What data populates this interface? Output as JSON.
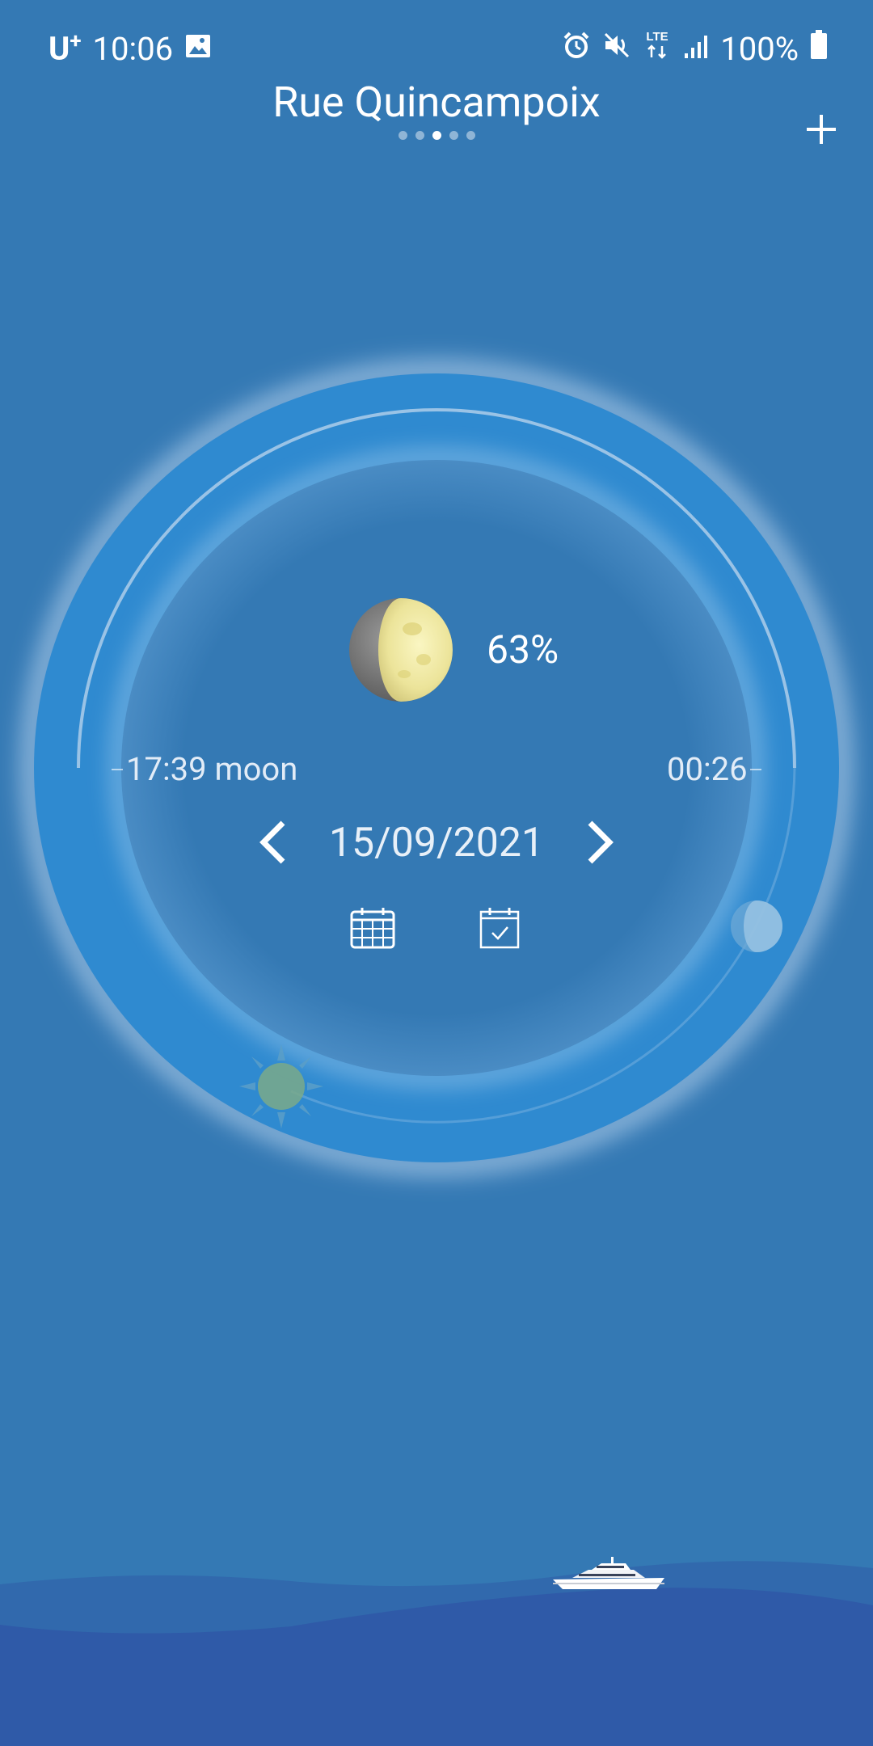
{
  "status_bar": {
    "carrier": "U",
    "carrier_suffix": "+",
    "time": "10:06",
    "network": "LTE",
    "battery": "100%",
    "icons": [
      "image-icon",
      "alarm-icon",
      "mute-icon",
      "lte-icon",
      "signal-icon",
      "battery-icon"
    ]
  },
  "header": {
    "location": "Rue Quincampoix",
    "pages": 5,
    "active_page": 3
  },
  "moon": {
    "illumination": "63%",
    "rise_label": "17:39 moon",
    "set_label": "00:26",
    "date": "15/09/2021"
  },
  "colors": {
    "background": "#3479b4",
    "ring": "#2f8ad0",
    "sea": "#2f5aa8"
  }
}
